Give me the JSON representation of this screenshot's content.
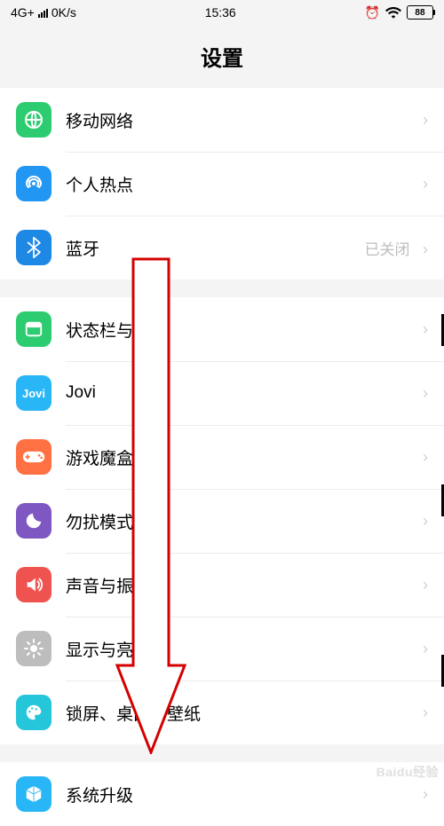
{
  "status": {
    "network": "4G+",
    "speed": "0K/s",
    "time": "15:36",
    "battery": "88"
  },
  "header": {
    "title": "设置"
  },
  "items": {
    "network": {
      "label": "移动网络"
    },
    "hotspot": {
      "label": "个人热点"
    },
    "bluetooth": {
      "label": "蓝牙",
      "value": "已关闭"
    },
    "statusbar": {
      "label": "状态栏与通知"
    },
    "jovi": {
      "label": "Jovi"
    },
    "game": {
      "label": "游戏魔盒"
    },
    "dnd": {
      "label": "勿扰模式"
    },
    "sound": {
      "label": "声音与振动"
    },
    "display": {
      "label": "显示与亮度"
    },
    "lock": {
      "label": "锁屏、桌面与壁纸"
    },
    "update": {
      "label": "系统升级"
    }
  },
  "watermark": "Baidu经验"
}
